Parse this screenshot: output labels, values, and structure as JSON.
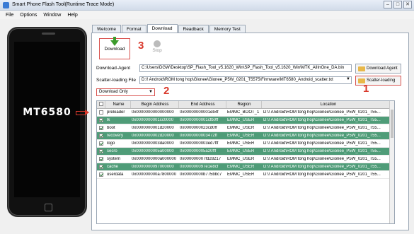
{
  "window": {
    "title": "Smart Phone Flash Tool(Runtime Trace Mode)",
    "controls": [
      "‒",
      "□",
      "✕"
    ]
  },
  "menu": [
    "File",
    "Options",
    "Window",
    "Help"
  ],
  "phone": {
    "chip_label": "MT6580"
  },
  "tabs": [
    "Welcome",
    "Format",
    "Download",
    "Readback",
    "Memory Test"
  ],
  "toolbar": {
    "download_label": "Download",
    "stop_label": "Stop"
  },
  "annotations": {
    "n1": "1",
    "n2": "2",
    "n3": "3"
  },
  "download_agent": {
    "label": "Download-Agent",
    "value": "C:\\Users\\DGW\\Desktop\\SP_Flash_Tool_v5.1620_Win\\SP_Flash_Tool_v5.1620_Win\\MTK_AllInOne_DA.bin",
    "button": "Download Agent"
  },
  "scatter": {
    "label": "Scatter-loading File",
    "value": "D:\\! Android\\ROM tong hop\\Gionee\\Gionee_P5W_0201_T5575\\Firmware\\MT6580_Android_scatter.txt",
    "button": "Scatter-loading"
  },
  "mode": {
    "selected": "Download Only"
  },
  "table": {
    "columns": [
      "Name",
      "Begin Address",
      "End Address",
      "Region",
      "Location"
    ],
    "rows": [
      {
        "checked": false,
        "highlight": false,
        "name": "preloader",
        "begin": "0x0000000000000000",
        "end": "0x00000000001eb4f",
        "region": "EMMC_BOOT_1",
        "location": "D:\\! Android\\ROM tong hop\\Gionee\\Gionee_P5W_0201_T55..."
      },
      {
        "checked": true,
        "highlight": true,
        "name": "lk",
        "begin": "0x0000000001cc0000",
        "end": "0x0000000001cfb0ff",
        "region": "EMMC_USER",
        "location": "D:\\! Android\\ROM tong hop\\Gionee\\Gionee_P5W_0201_T55..."
      },
      {
        "checked": true,
        "highlight": false,
        "name": "boot",
        "begin": "0x0000000001d20000",
        "end": "0x0000000023cd0ff",
        "region": "EMMC_USER",
        "location": "D:\\! Android\\ROM tong hop\\Gionee\\Gionee_P5W_0201_T55..."
      },
      {
        "checked": true,
        "highlight": true,
        "name": "recovery",
        "begin": "0x0000000002d20000",
        "end": "0x0000000003472ff",
        "region": "EMMC_USER",
        "location": "D:\\! Android\\ROM tong hop\\Gionee\\Gionee_P5W_0201_T55..."
      },
      {
        "checked": true,
        "highlight": false,
        "name": "logo",
        "begin": "0x0000000003da0000",
        "end": "0x0000000003ed7fff",
        "region": "EMMC_USER",
        "location": "D:\\! Android\\ROM tong hop\\Gionee\\Gionee_P5W_0201_T55..."
      },
      {
        "checked": true,
        "highlight": true,
        "name": "secro",
        "begin": "0x0000000005a00000",
        "end": "0x000000005a20fff",
        "region": "EMMC_USER",
        "location": "D:\\! Android\\ROM tong hop\\Gionee\\Gionee_P5W_0201_T55..."
      },
      {
        "checked": true,
        "highlight": false,
        "name": "system",
        "begin": "0x0000000000a000000",
        "end": "0x000000007fd28217",
        "region": "EMMC_USER",
        "location": "D:\\! Android\\ROM tong hop\\Gionee\\Gionee_P5W_0201_T55..."
      },
      {
        "checked": true,
        "highlight": true,
        "name": "cache",
        "begin": "0x0000000097000000",
        "end": "0x000000097e1e8cf",
        "region": "EMMC_USER",
        "location": "D:\\! Android\\ROM tong hop\\Gionee\\Gionee_P5W_0201_T55..."
      },
      {
        "checked": true,
        "highlight": false,
        "name": "userdata",
        "begin": "0x000000000a7800000",
        "end": "0x00000000b775bbc7",
        "region": "EMMC_USER",
        "location": "D:\\! Android\\ROM tong hop\\Gionee\\Gionee_P5W_0201_T55..."
      }
    ]
  },
  "colors": {
    "row_highlight": "#4f9c78",
    "annotation": "#d9382b"
  }
}
